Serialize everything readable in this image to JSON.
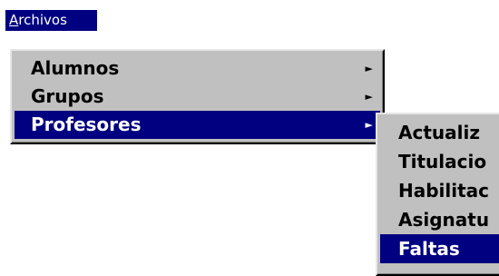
{
  "menubar": {
    "archivos_accel": "A",
    "archivos_rest": "rchivos"
  },
  "main_menu": {
    "items": [
      {
        "label": "Alumnos",
        "has_submenu": true,
        "selected": false
      },
      {
        "label": "Grupos",
        "has_submenu": true,
        "selected": false
      },
      {
        "label": "Profesores",
        "has_submenu": true,
        "selected": true
      }
    ],
    "submenu_arrow": "►"
  },
  "profesores_menu": {
    "items": [
      {
        "label": "Actualiz",
        "selected": false
      },
      {
        "label": "Titulacio",
        "selected": false
      },
      {
        "label": "Habilitac",
        "selected": false
      },
      {
        "label": "Asignatu",
        "selected": false
      },
      {
        "label": "Faltas",
        "selected": true
      }
    ]
  },
  "colors": {
    "menu_bg": "#c0c0c0",
    "highlight": "#000080",
    "highlight_text": "#ffffff"
  }
}
